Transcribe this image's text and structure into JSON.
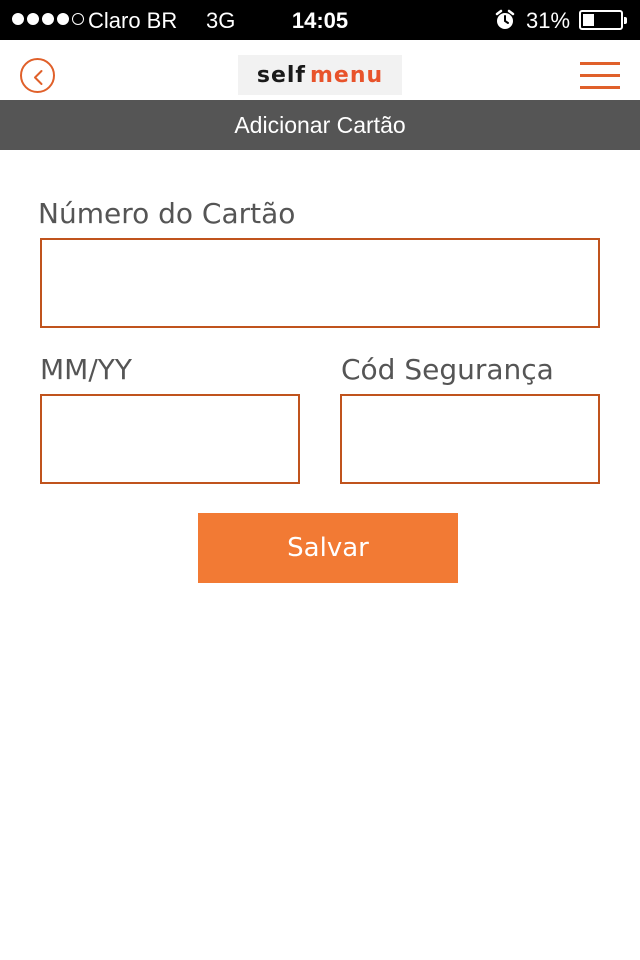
{
  "status_bar": {
    "signal_dots": 5,
    "signal_filled": 4,
    "carrier": "Claro BR",
    "network": "3G",
    "time": "14:05",
    "alarm_icon": "alarm-clock-icon",
    "battery_percent_label": "31%",
    "battery_level": 0.31
  },
  "nav": {
    "back_icon": "chevron-left-icon",
    "logo_self": "self",
    "logo_menu": "menu",
    "menu_icon": "hamburger-menu-icon",
    "accent_color": "#e0602a"
  },
  "page": {
    "title": "Adicionar Cartão"
  },
  "form": {
    "card_number_label": "Número do Cartão",
    "card_number_value": "",
    "expiry_label": "MM/YY",
    "expiry_value": "",
    "security_code_label": "Cód Segurança",
    "security_code_value": "",
    "save_label": "Salvar",
    "button_color": "#f27a34",
    "border_color": "#c0531d"
  }
}
